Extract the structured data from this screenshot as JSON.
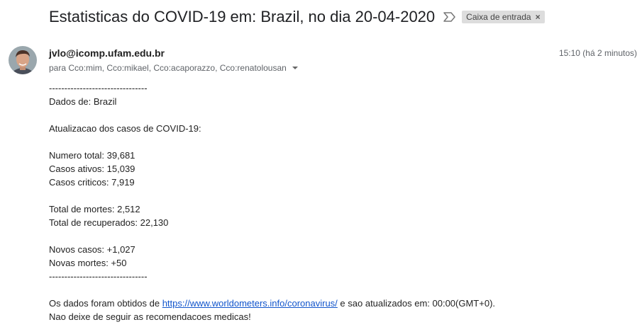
{
  "subject": "Estatisticas do COVID-19 em: Brazil, no dia 20-04-2020",
  "label": "Caixa de entrada",
  "label_close": "×",
  "sender": "jvlo@icomp.ufam.edu.br",
  "recipients": "para Cco:mim, Cco:mikael, Cco:acaporazzo, Cco:renatolousan",
  "timestamp": "15:10 (há 2 minutos)",
  "body": {
    "sep1": "--------------------------------",
    "dados": "Dados de: Brazil",
    "atualizacao": "Atualizacao dos casos de COVID-19:",
    "numero_total": "Numero total: 39,681",
    "casos_ativos": "Casos ativos: 15,039",
    "casos_criticos": "Casos criticos: 7,919",
    "total_mortes": "Total de mortes: 2,512",
    "total_recuperados": "Total de recuperados: 22,130",
    "novos_casos": "Novos casos: +1,027",
    "novas_mortes": "Novas mortes: +50",
    "sep2": "--------------------------------",
    "fonte_prefix": "Os dados foram obtidos de ",
    "fonte_link": "https://www.worldometers.info/coronavirus/",
    "fonte_suffix": " e sao atualizados em: 00:00(GMT+0).",
    "recomendacao": "Nao deixe de seguir as recomendacoes medicas!"
  },
  "colors": {
    "link": "#1155cc",
    "muted": "#5f6368",
    "chip_bg": "#dddddd"
  },
  "icons": {
    "importance": "importance-marker-icon",
    "caret": "caret-down-icon",
    "avatar": "avatar"
  }
}
